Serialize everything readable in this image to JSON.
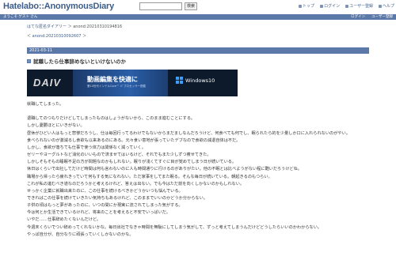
{
  "header": {
    "logo": "Hatelabo::AnonymousDiary",
    "search_placeholder": "",
    "search_button": "検索",
    "links": [
      "トップ",
      "ログイン",
      "ユーザー登録",
      "ヘルプ"
    ]
  },
  "userbar": {
    "left": "ようこそ ゲスト さん",
    "right": [
      "ログイン",
      "ユーザー登録"
    ]
  },
  "breadcrumbs": {
    "line1_link": "はてな匿名ダイアリー",
    "line1_sep": "＞",
    "line1_current": "anond:20210310194816",
    "line2_prefix": "＜",
    "line2_link": "anond:20210310092607",
    "line2_suffix": "＞"
  },
  "date": "2021-03-11",
  "entry": {
    "title": "就職したら仕事辞めないといけないのか"
  },
  "ad": {
    "brand": "DAIV",
    "headline": "動画編集を快適に",
    "sub": "第10世代インテルCore™ i7 プロセッサー搭載",
    "os": "Windows10"
  },
  "paragraphs": [
    "就職してしまった。",
    "",
    "退職してのつもりだけどしてしまったものはしょうがないから、このまま進むことにする。",
    "しかし憂鬱ほとにいきがない。",
    "昼休がひどい人はもっと悲惨だろうし、仕は毎回行ってるわけでもないからまだましなんだろうけど、何食べても何でし、眠られたら的を少量しか口に入れられないのがやい。",
    "食べられないのが激減るし食欲も以来あるのにある。元々食い意地が張っていたデブなので食欲の減退自体は不だ。",
    "しかし、食欲が落ちても仕事で使う体力は関係なく減っていく。",
    "ゼリーやヨーグルトなど消化のいいもので済ませてはいるけど、それでもまた少しずつ痩せてきた。",
    "しかしそもそもの睡眠不足の方が問題なのかもしれない。眠りが浅くてすぐに目が覚めてしまう日が続いている。",
    "休日はくらいで出社してだけど時間は何も言わないのに人も時間通りに行けるのがありがたい。他の不眠とは比べようがない程に酷いだろうけどね。",
    "職場から帰ったら疲れきっていて何もする気になれない。ただ家事をしてまた眠る。そんな毎日が続いている。朝起きるのもつらい。",
    "これが私の進むべき道なのだろうかと考えるけれど、答えは出ない。でも今はただ前を向くしかないのかもしれない。",
    "せっかく企業に就職出来たのに、この仕事を続けるべきかどうかいつも悩んでいる。",
    "できればこの仕事を続けていきたい気持ちもあるけれど、このままでいいのかどうか分からない。",
    "子供の頃はもっと夢があったのに、いつの間にか現実に流されてしまった気がする。",
    "今は何とか生活できているけれど、将来のことを考えると不安でいっぱいだ。",
    "いやだ……仕事辞めたくないんだけど。",
    "今週末くらいでつい辞めってくれないかな。毎日出社でなきゃ時間を無駄にしてしまう気がして、ずっと考えてしまうんだけどどうしたらいいのかわからない。",
    "やっぱ自分が、自分なりに頑張っていくしかないのかな。"
  ]
}
